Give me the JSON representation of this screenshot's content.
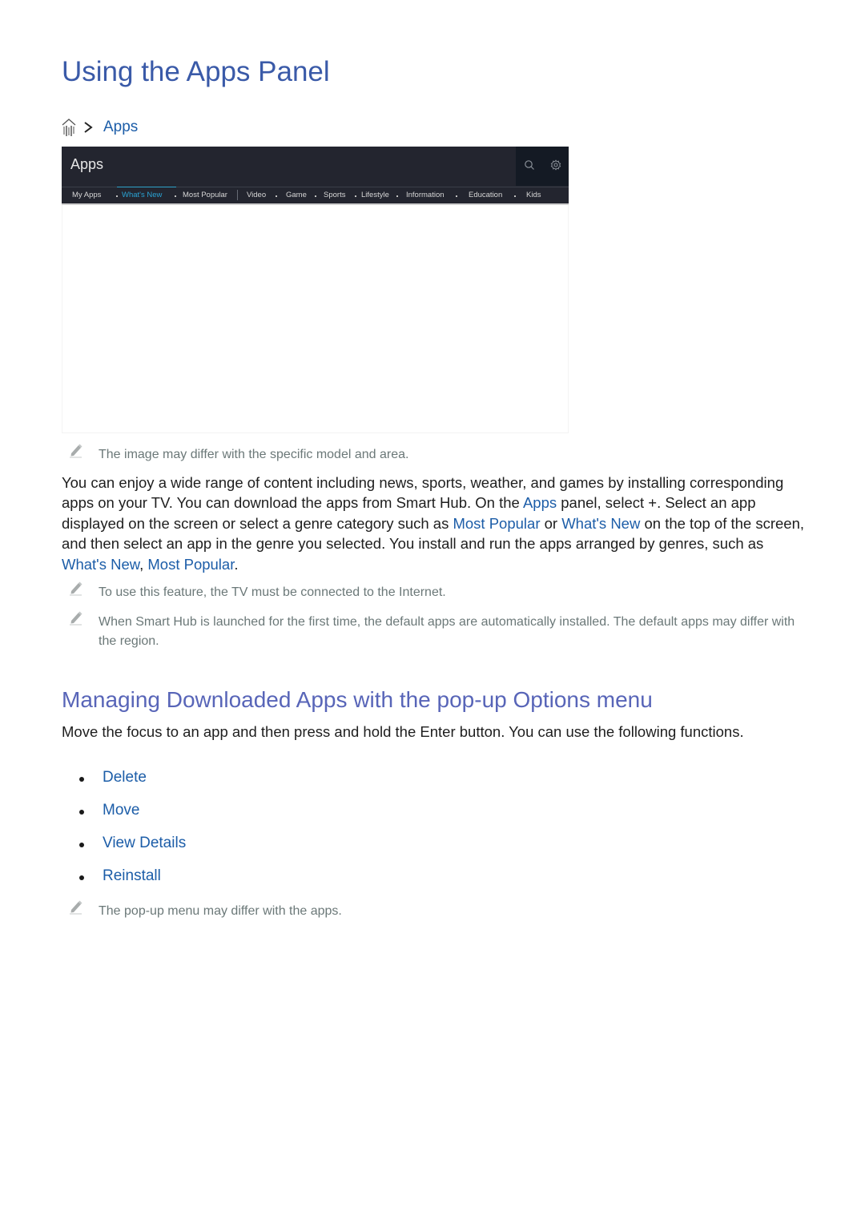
{
  "page": {
    "title": "Using the Apps Panel"
  },
  "breadcrumb": {
    "home_icon": "home-icon",
    "separator_icon": "chevron-right-icon",
    "items": [
      "Apps"
    ]
  },
  "apps_panel": {
    "title": "Apps",
    "search_icon": "search-icon",
    "settings_icon": "gear-icon",
    "active_tab": "What's New",
    "tabs": [
      {
        "label": "My Apps"
      },
      {
        "label": "What's New"
      },
      {
        "label": "Most Popular"
      },
      {
        "label": "Video"
      },
      {
        "label": "Game"
      },
      {
        "label": "Sports"
      },
      {
        "label": "Lifestyle"
      },
      {
        "label": "Information"
      },
      {
        "label": "Education"
      },
      {
        "label": "Kids"
      }
    ],
    "colors": {
      "background": "#23252f",
      "active_tab": "#2aa3d4"
    }
  },
  "notes": {
    "image_note": "The image may differ with the specific model and area.",
    "internet_note": "To use this feature, the TV must be connected to the Internet.",
    "default_apps_note": "When Smart Hub is launched for the first time, the default apps are automatically installed. The default apps may differ with the region.",
    "popup_note": "The pop-up menu may differ with the apps."
  },
  "intro": {
    "t1": "You can enjoy a wide range of content including news, sports, weather, and games by installing corresponding apps on your TV. You can download the apps from Smart Hub. On the ",
    "k1": "Apps",
    "t2": " panel, select +. Select an app displayed on the screen or select a genre category such as ",
    "k2": "Most Popular",
    "t3": " or ",
    "k3": "What's New",
    "t4": " on the top of the screen, and then select an app in the genre you selected. You install and run the apps arranged by genres, such as ",
    "k4": "What's New",
    "t5": ", ",
    "k5": "Most Popular",
    "t6": "."
  },
  "section2": {
    "heading": "Managing Downloaded Apps with the pop-up Options menu",
    "body": "Move the focus to an app and then press and hold the Enter button. You can use the following functions.",
    "options": [
      {
        "label": "Delete"
      },
      {
        "label": "Move"
      },
      {
        "label": "View Details"
      },
      {
        "label": "Reinstall"
      }
    ]
  },
  "colors": {
    "title": "#3a5aa8",
    "heading2": "#5865b8",
    "link": "#1c5da8",
    "note_text": "#6b7878"
  }
}
